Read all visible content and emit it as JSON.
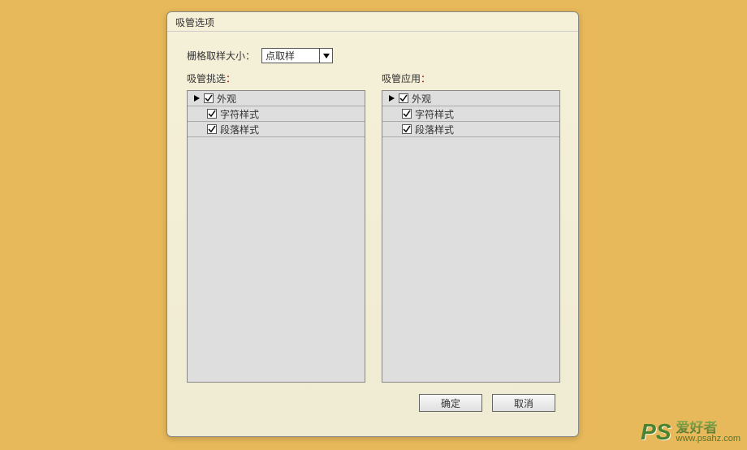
{
  "dialog": {
    "title": "吸管选项",
    "sample": {
      "label": "栅格取样大小：",
      "selected": "点取样"
    },
    "leftLabel": "吸管挑选",
    "rightLabel": "吸管应用",
    "colon": "：",
    "tree": {
      "item0": "外观",
      "item1": "字符样式",
      "item2": "段落样式"
    },
    "buttons": {
      "ok": "确定",
      "cancel": "取消"
    }
  },
  "watermark": {
    "logo": "PS",
    "cn": "爱好者",
    "url": "www.psahz.com"
  }
}
